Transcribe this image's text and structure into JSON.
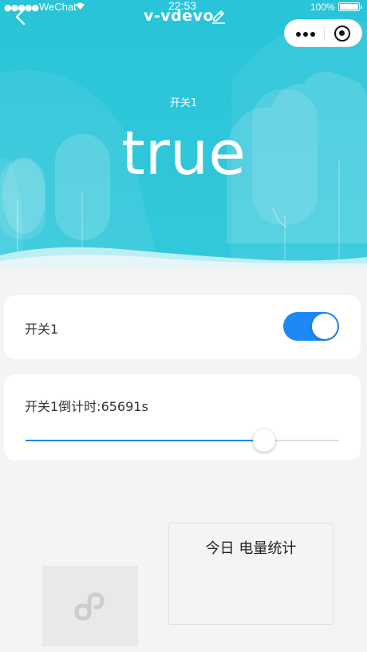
{
  "status_bar": {
    "signal": "●●●●●",
    "carrier": "WeChat",
    "time": "22:53",
    "battery": "100%"
  },
  "nav": {
    "title": "v-vdevo",
    "back_icon": "chevron-left-icon",
    "edit_icon": "pencil-icon",
    "capsule_more_icon": "more-dots-icon",
    "capsule_close_icon": "target-circle-icon"
  },
  "hero": {
    "label": "开关1",
    "value": "true"
  },
  "switch_card": {
    "label": "开关1",
    "on": true
  },
  "timer_card": {
    "label": "开关1倒计时:65691s",
    "slider_fraction": 0.76
  },
  "stats_card": {
    "title": "今日 电量统计"
  },
  "placeholder": {
    "icon": "miniprogram-logo-icon"
  },
  "colors": {
    "hero": "#2fc6da",
    "accent": "#1e88f5",
    "background": "#f4f4f4"
  }
}
